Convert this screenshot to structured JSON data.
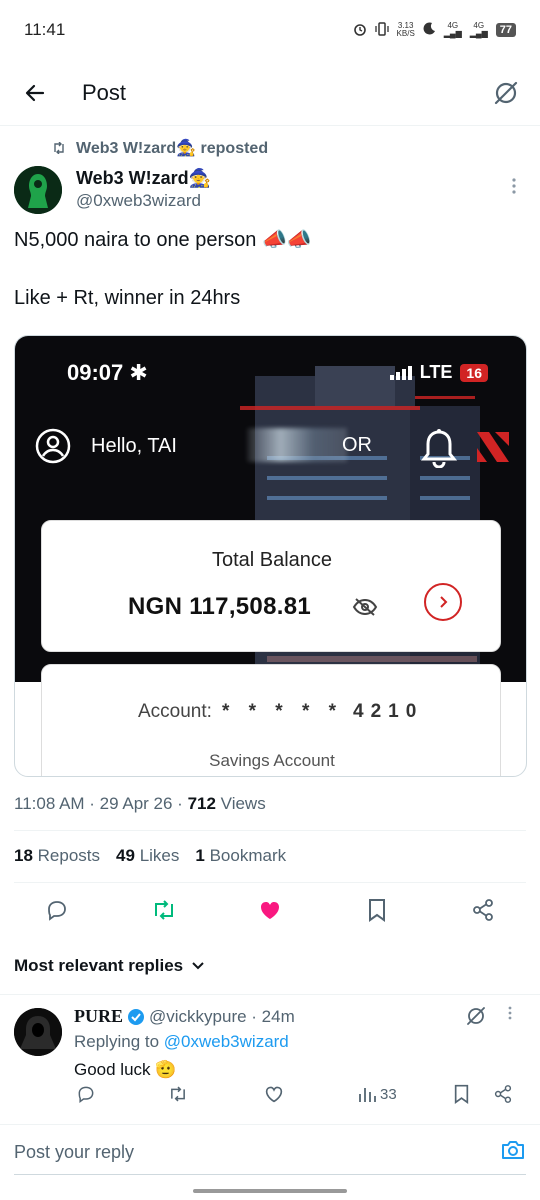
{
  "status_bar": {
    "time": "11:41",
    "net_speed_top": "3.13",
    "net_speed_bottom": "KB/S",
    "signal1": "4G",
    "signal2": "4G",
    "battery": "77"
  },
  "header": {
    "title": "Post"
  },
  "tweet": {
    "repost_label": "Web3 W!zard🧙 reposted",
    "author_name": "Web3 W!zard🧙",
    "author_handle": "@0xweb3wizard",
    "text": "N5,000 naira to one person 📣📣\n\nLike + Rt, winner in 24hrs",
    "media": {
      "phone_time": "09:07",
      "network": "LTE",
      "phone_battery": "16",
      "greeting": "Hello, TAI",
      "greeting_suffix": "OR",
      "balance_label": "Total Balance",
      "balance_value": "NGN 117,508.81",
      "account_label": "Account:",
      "account_mask": "* * * * *",
      "account_digits": "4210",
      "account_type": "Savings Account",
      "accent_color": "#d12424"
    },
    "timestamp": "11:08 AM · 29 Apr 26 · ",
    "views_count": "712",
    "views_label": " Views",
    "reposts_count": "18",
    "reposts_label": "Reposts",
    "likes_count": "49",
    "likes_label": "Likes",
    "bookmarks_count": "1",
    "bookmarks_label": "Bookmark",
    "liked": true,
    "reposted": true
  },
  "replies_section": {
    "sort_label": "Most relevant replies"
  },
  "reply": {
    "name": "PURE",
    "verified": true,
    "handle_time": "@vickkypure · 24m",
    "replying_prefix": "Replying to ",
    "replying_handle": "@0xweb3wizard",
    "text": "Good luck 🫡",
    "views": "33"
  },
  "compose": {
    "placeholder": "Post your reply"
  },
  "colors": {
    "accent_blue": "#1d9bf0",
    "like_pink": "#f91880",
    "repost_green": "#00ba7c",
    "muted": "#536471"
  }
}
